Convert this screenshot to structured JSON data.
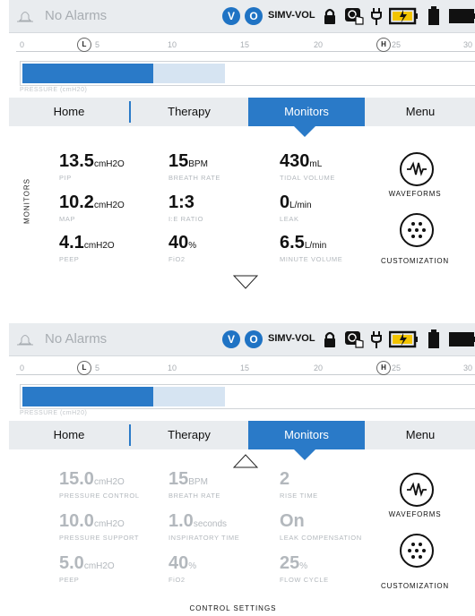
{
  "status": {
    "alarm_text": "No Alarms",
    "badge_v": "V",
    "badge_o": "O",
    "mode": "SIMV-VOL",
    "icons": [
      "bell-icon",
      "lock-icon",
      "touch-icon",
      "plug-icon",
      "battery-charging-icon",
      "battery-icon",
      "battery-full-icon"
    ]
  },
  "ruler": {
    "ticks": [
      "0",
      "5",
      "10",
      "15",
      "20",
      "25",
      "30"
    ],
    "low_marker": "L",
    "high_marker": "H"
  },
  "pressure_bar": {
    "label": "PRESSURE (cmH20)",
    "level_fraction": 0.29,
    "target_fraction": 0.45
  },
  "nav": {
    "home": "Home",
    "therapy": "Therapy",
    "monitors": "Monitors",
    "menu": "Menu",
    "active": "Monitors"
  },
  "monitors_panel": {
    "side_label": "MONITORS",
    "items": [
      {
        "value": "13.5",
        "unit": "cmH2O",
        "label": "PIP"
      },
      {
        "value": "15",
        "unit": "BPM",
        "label": "BREATH RATE"
      },
      {
        "value": "430",
        "unit": "mL",
        "label": "TIDAL VOLUME"
      },
      {
        "value": "10.2",
        "unit": "cmH2O",
        "label": "MAP"
      },
      {
        "value": "1:3",
        "unit": "",
        "label": "I:E RATIO"
      },
      {
        "value": "0",
        "unit": "L/min",
        "label": "LEAK"
      },
      {
        "value": "4.1",
        "unit": "cmH2O",
        "label": "PEEP"
      },
      {
        "value": "40",
        "unit": "%",
        "label": "FiO2"
      },
      {
        "value": "6.5",
        "unit": "L/min",
        "label": "MINUTE VOLUME"
      }
    ],
    "waveforms": "WAVEFORMS",
    "customization": "CUSTOMIZATION"
  },
  "settings_panel": {
    "footer": "CONTROL SETTINGS",
    "items": [
      {
        "value": "15.0",
        "unit": "cmH2O",
        "label": "PRESSURE CONTROL"
      },
      {
        "value": "15",
        "unit": "BPM",
        "label": "BREATH RATE"
      },
      {
        "value": "2",
        "unit": "",
        "label": "RISE TIME"
      },
      {
        "value": "10.0",
        "unit": "cmH2O",
        "label": "PRESSURE SUPPORT"
      },
      {
        "value": "1.0",
        "unit": "seconds",
        "label": "INSPIRATORY TIME"
      },
      {
        "value": "On",
        "unit": "",
        "label": "LEAK COMPENSATION"
      },
      {
        "value": "5.0",
        "unit": "cmH2O",
        "label": "PEEP"
      },
      {
        "value": "40",
        "unit": "%",
        "label": "FiO2"
      },
      {
        "value": "25",
        "unit": "%",
        "label": "FLOW CYCLE"
      }
    ],
    "waveforms": "WAVEFORMS",
    "customization": "CUSTOMIZATION"
  }
}
